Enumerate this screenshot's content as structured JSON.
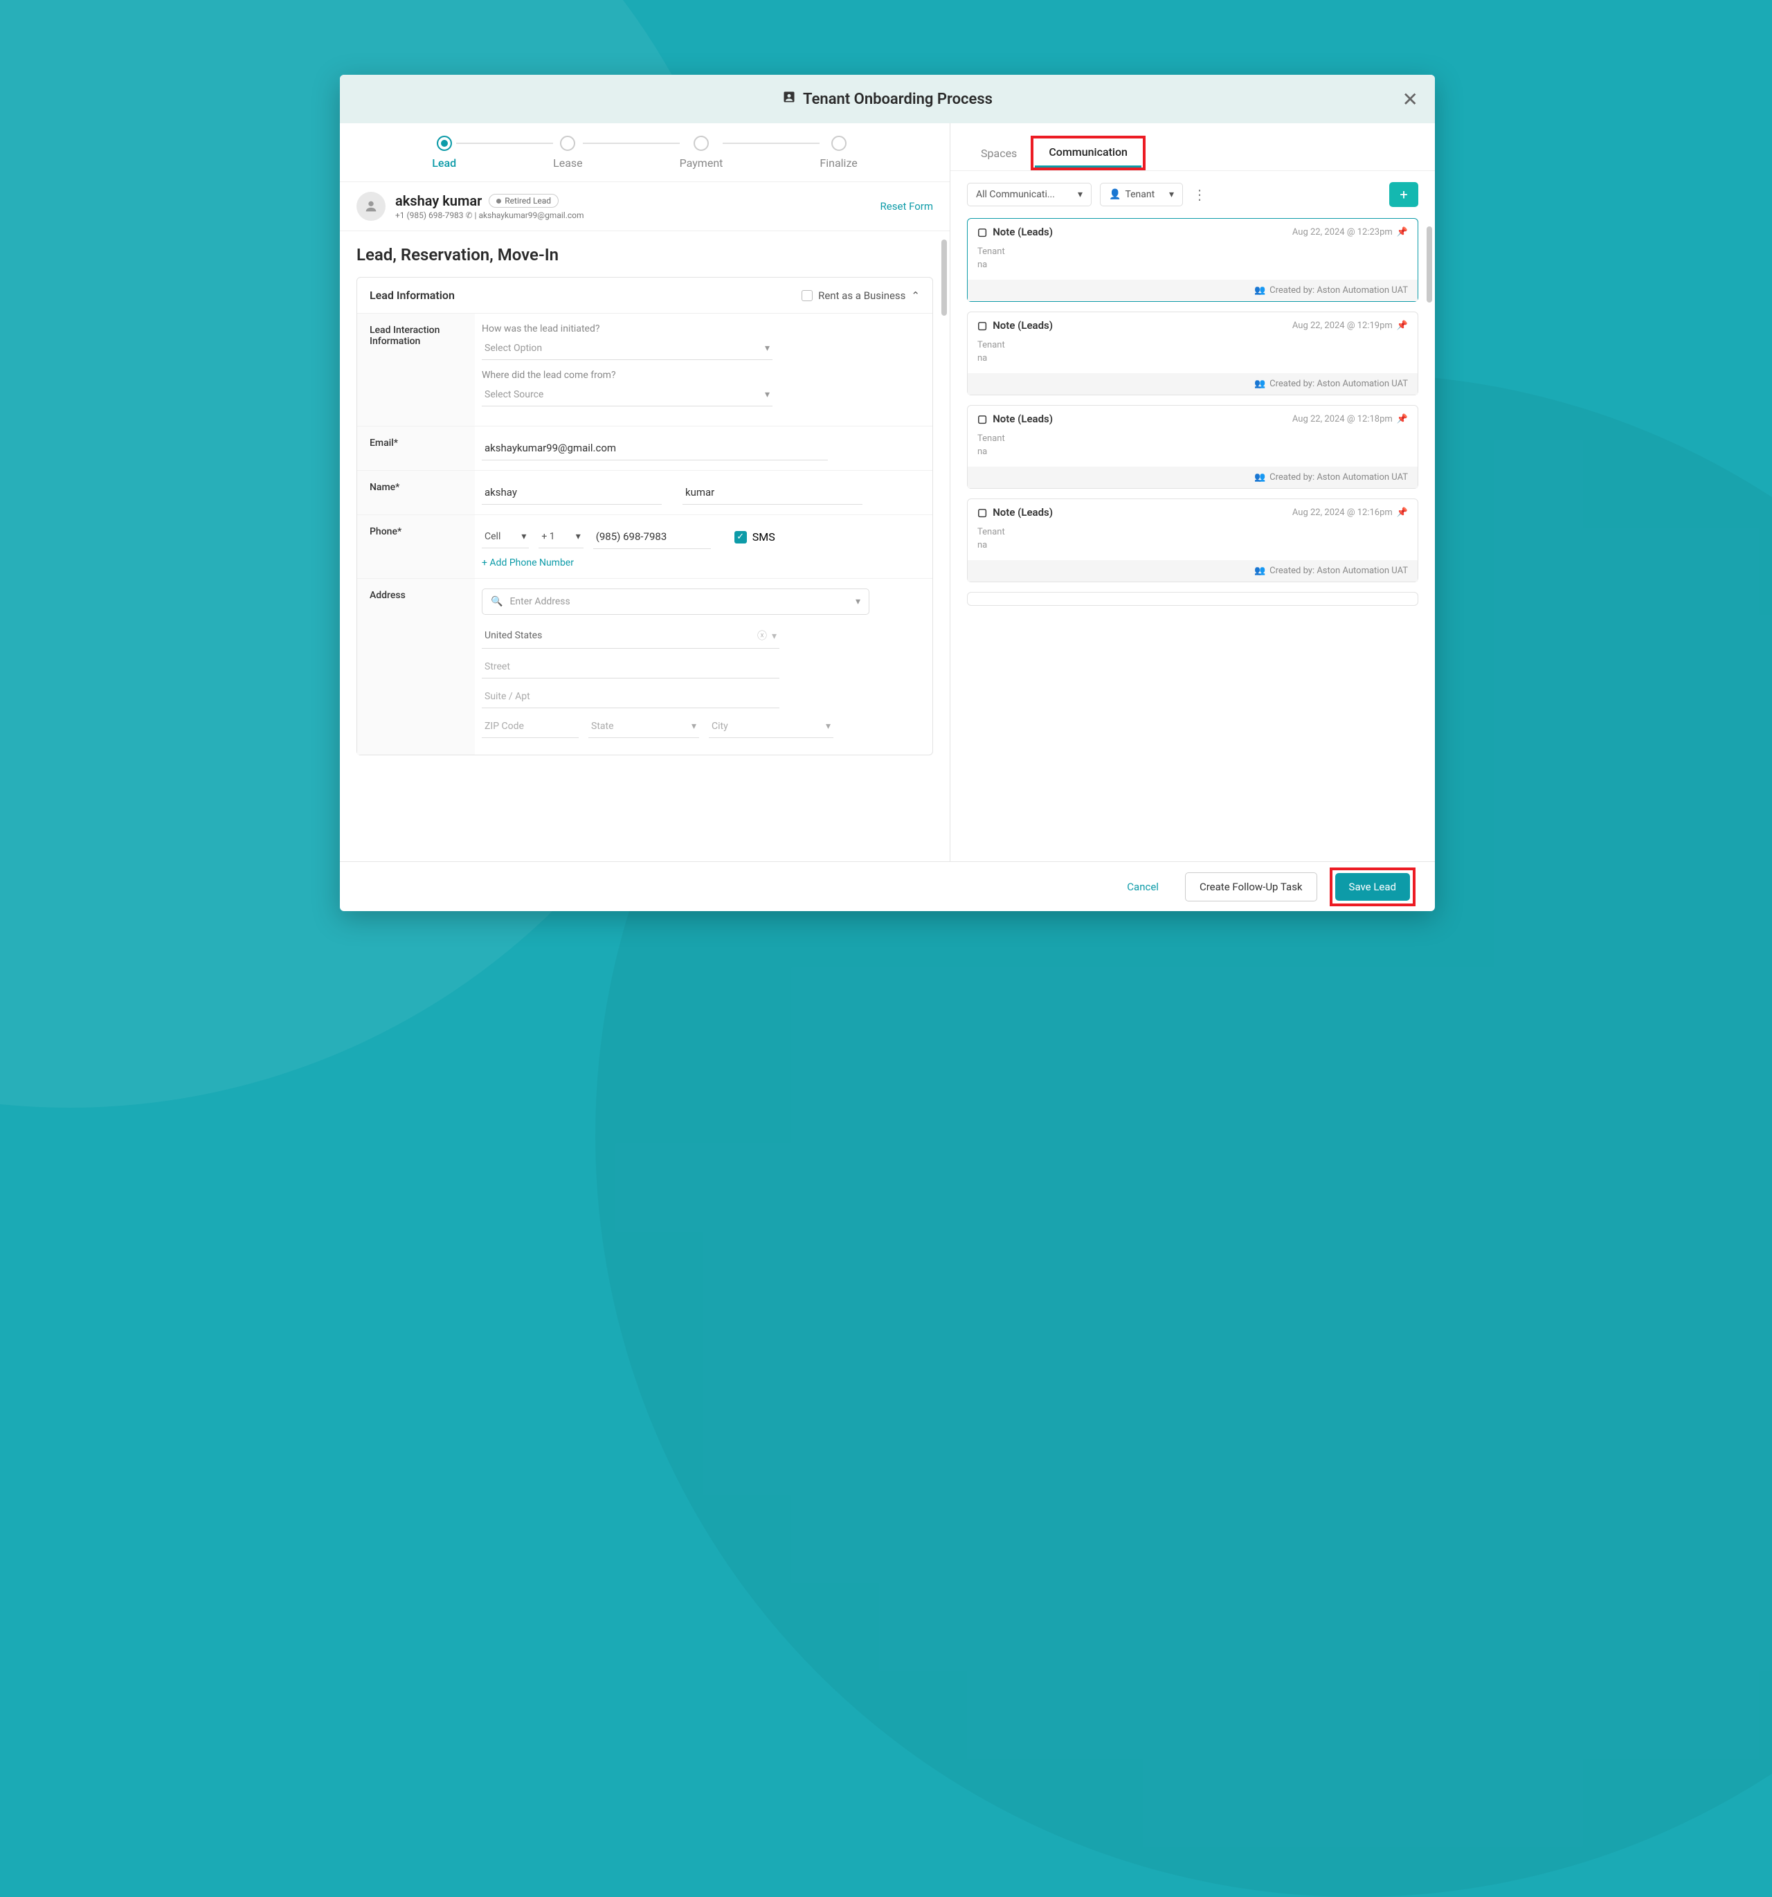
{
  "modal": {
    "title": "Tenant Onboarding Process"
  },
  "steps": [
    {
      "label": "Lead"
    },
    {
      "label": "Lease"
    },
    {
      "label": "Payment"
    },
    {
      "label": "Finalize"
    }
  ],
  "person": {
    "name": "akshay kumar",
    "badge": "Retired Lead",
    "sub": "+1 (985) 698-7983 ✆ | akshaykumar99@gmail.com",
    "reset": "Reset Form"
  },
  "section_title": "Lead, Reservation, Move-In",
  "lead_card": {
    "title": "Lead Information",
    "rent_business": "Rent as a Business"
  },
  "rows": {
    "interaction_label": "Lead Interaction Information",
    "q1": "How was the lead initiated?",
    "sel1": "Select Option",
    "q2": "Where did the lead come from?",
    "sel2": "Select Source",
    "email_label": "Email*",
    "email_value": "akshaykumar99@gmail.com",
    "name_label": "Name*",
    "first_name": "akshay",
    "last_name": "kumar",
    "phone_label": "Phone*",
    "phone_type": "Cell",
    "phone_cc": "+ 1",
    "phone_num": "(985) 698-7983",
    "sms": "SMS",
    "add_phone": "+ Add Phone Number",
    "address_label": "Address",
    "address_search": "Enter Address",
    "country": "United States",
    "street": "Street",
    "suite": "Suite / Apt",
    "zip": "ZIP Code",
    "state": "State",
    "city": "City"
  },
  "rtabs": {
    "spaces": "Spaces",
    "comm": "Communication"
  },
  "filter": {
    "all": "All Communicati...",
    "tenant": "Tenant"
  },
  "notes": [
    {
      "title": "Note (Leads)",
      "date": "Aug 22, 2024 @ 12:23pm",
      "l1": "Tenant",
      "l2": "na",
      "by": "Created by: Aston Automation UAT"
    },
    {
      "title": "Note (Leads)",
      "date": "Aug 22, 2024 @ 12:19pm",
      "l1": "Tenant",
      "l2": "na",
      "by": "Created by: Aston Automation UAT"
    },
    {
      "title": "Note (Leads)",
      "date": "Aug 22, 2024 @ 12:18pm",
      "l1": "Tenant",
      "l2": "na",
      "by": "Created by: Aston Automation UAT"
    },
    {
      "title": "Note (Leads)",
      "date": "Aug 22, 2024 @ 12:16pm",
      "l1": "Tenant",
      "l2": "na",
      "by": "Created by: Aston Automation UAT"
    }
  ],
  "footer": {
    "cancel": "Cancel",
    "followup": "Create Follow-Up Task",
    "save": "Save Lead"
  }
}
